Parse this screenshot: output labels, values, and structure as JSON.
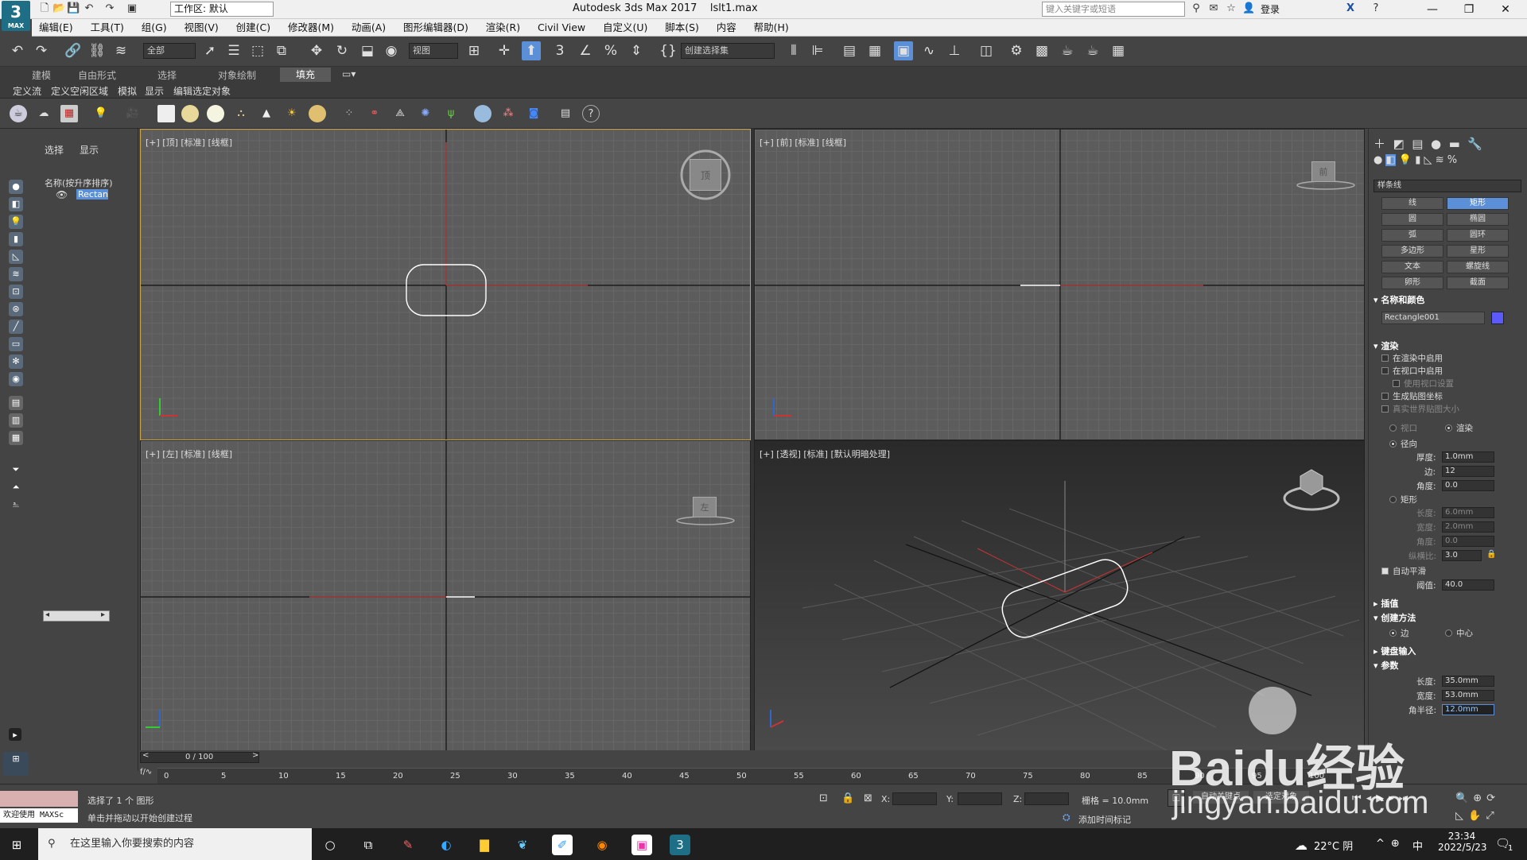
{
  "titlebar": {
    "logo_main": "3",
    "logo_sub": "MAX",
    "workspace": "工作区: 默认",
    "app_title": "Autodesk 3ds Max 2017",
    "file_name": "lslt1.max",
    "search_placeholder": "键入关键字或短语",
    "login": "登录"
  },
  "menu": [
    "编辑(E)",
    "工具(T)",
    "组(G)",
    "视图(V)",
    "创建(C)",
    "修改器(M)",
    "动画(A)",
    "图形编辑器(D)",
    "渲染(R)",
    "Civil View",
    "自定义(U)",
    "脚本(S)",
    "内容",
    "帮助(H)"
  ],
  "toolbar": {
    "selection_filter": "全部",
    "ref_coord": "视图",
    "named_selection": "创建选择集"
  },
  "ribbon_tabs": [
    "建模",
    "自由形式",
    "选择",
    "对象绘制",
    "填充"
  ],
  "ribbon_sub": [
    "定义流",
    "定义空闲区域",
    "模拟",
    "显示",
    "编辑选定对象"
  ],
  "explorer": {
    "tabs": [
      "选择",
      "显示"
    ],
    "header": "名称(按升序排序)",
    "item": "Rectangl"
  },
  "viewports": {
    "top": "[+] [顶] [标准] [线框]",
    "front": "[+] [前] [标准] [线框]",
    "left": "[+] [左] [标准] [线框]",
    "persp": "[+] [透视] [标准] [默认明暗处理]",
    "cube_top": "顶",
    "cube_front": "前",
    "cube_left": "左"
  },
  "cmdpanel": {
    "category": "样条线",
    "buttons": [
      "线",
      "矩形",
      "圆",
      "椭圆",
      "弧",
      "圆环",
      "多边形",
      "星形",
      "文本",
      "螺旋线",
      "卵形",
      "截面"
    ],
    "name_color": "名称和颜色",
    "object_name": "Rectangle001",
    "object_color": "#5a5aff",
    "render": "渲染",
    "render_opts": [
      "在渲染中启用",
      "在视口中启用",
      "使用视口设置",
      "生成贴图坐标",
      "真实世界贴图大小"
    ],
    "viewport_opt": "视口",
    "render_opt": "渲染",
    "radial": "径向",
    "thickness_l": "厚度:",
    "thickness_v": "1.0mm",
    "sides_l": "边:",
    "sides_v": "12",
    "angle_l": "角度:",
    "angle_v": "0.0",
    "rect": "矩形",
    "length_l": "长度:",
    "length_v": "6.0mm",
    "width_l": "宽度:",
    "width_v": "2.0mm",
    "angle2_l": "角度:",
    "angle2_v": "0.0",
    "aspect_l": "纵横比:",
    "aspect_v": "3.0",
    "autosmooth": "自动平滑",
    "threshold_l": "阈值:",
    "threshold_v": "40.0",
    "interp": "插值",
    "create_method": "创建方法",
    "edge": "边",
    "center": "中心",
    "keyboard": "键盘输入",
    "params": "参数",
    "p_length_l": "长度:",
    "p_length_v": "35.0mm",
    "p_width_l": "宽度:",
    "p_width_v": "53.0mm",
    "p_corner_l": "角半径:",
    "p_corner_v": "12.0mm"
  },
  "timeline": {
    "counter": "0 / 100",
    "ticks": [
      "0",
      "5",
      "10",
      "15",
      "20",
      "25",
      "30",
      "35",
      "40",
      "45",
      "50",
      "55",
      "60",
      "65",
      "70",
      "75",
      "80",
      "85",
      "90",
      "95",
      "100"
    ]
  },
  "status": {
    "welcome": "欢迎使用 MAXSc",
    "selected": "选择了 1 个 图形",
    "hint": "单击并拖动以开始创建过程",
    "x": "X:",
    "y": "Y:",
    "z": "Z:",
    "grid": "栅格 = 10.0mm",
    "add_tag": "添加时间标记",
    "autokey": "自动关键点",
    "setkey": "选定对象"
  },
  "taskbar": {
    "search": "在这里输入你要搜索的内容",
    "weather": "22°C 阴",
    "ime": "中",
    "time": "23:34",
    "date": "2022/5/23",
    "notify_count": "1"
  },
  "watermark": {
    "brand": "Baidu经验",
    "url": "jingyan.baidu.com"
  }
}
